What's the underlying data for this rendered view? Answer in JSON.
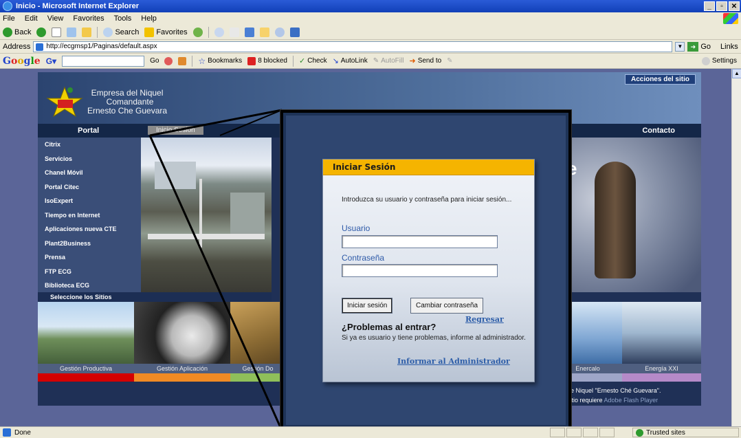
{
  "window": {
    "title": "Inicio - Microsoft Internet Explorer"
  },
  "menu": [
    "File",
    "Edit",
    "View",
    "Favorites",
    "Tools",
    "Help"
  ],
  "toolbar": {
    "back": "Back",
    "search": "Search",
    "favorites": "Favorites"
  },
  "address": {
    "label": "Address",
    "url": "http://ecgmsp1/Paginas/default.aspx",
    "go": "Go",
    "links": "Links"
  },
  "google": {
    "go": "Go",
    "bookmarks": "Bookmarks",
    "blocked": "8 blocked",
    "check": "Check",
    "autolink": "AutoLink",
    "autofill": "AutoFill",
    "sendto": "Send to",
    "settings": "Settings"
  },
  "site": {
    "topbar": {
      "acciones": "Acciones del sitio"
    },
    "logo_lines": [
      "Empresa del Niquel",
      "Comandante",
      "Ernesto Che Guevara"
    ],
    "nav": {
      "portal": "Portal",
      "inicio": "Inicio Sesión",
      "contacto": "Contacto"
    },
    "sidenav": [
      "Citrix",
      "Servicios",
      "Chanel Móvil",
      "Portal Citec",
      "IsoExpert",
      "Tiempo en Internet",
      "Aplicaciones nueva CTE",
      "Plant2Business",
      "Prensa",
      "FTP ECG",
      "Biblioteca ECG"
    ],
    "select_sites": "Seleccione los Sitios",
    "hero_letter": "e",
    "tile_labels": [
      "Gestión Productiva",
      "Gestión Aplicación",
      "Gestión Do",
      "Enercalo",
      "Energía XXI"
    ],
    "footer_line1": "de Niquel \"Ernesto Ché Guevara\".",
    "footer_line2": "sitio requiere",
    "footer_flash": "Adobe Flash Player",
    "colors": {
      "strip": [
        "#d40000",
        "#f08a24",
        "#8fbf5a",
        "#9ea6c8",
        "#b58ac8"
      ]
    }
  },
  "login": {
    "title": "Iniciar Sesión",
    "intro": "Introduzca su usuario y contraseña para iniciar sesión...",
    "user_label": "Usuario",
    "pass_label": "Contraseña",
    "btn_login": "Iniciar sesión",
    "btn_change": "Cambiar contraseña",
    "regresar": "Regresar",
    "problems_title": "¿Problemas al entrar?",
    "problems_text": "Si ya es usuario y tiene problemas, informe al administrador.",
    "inform_link": "Informar al Administrador"
  },
  "status": {
    "done": "Done",
    "zone": "Trusted sites"
  }
}
